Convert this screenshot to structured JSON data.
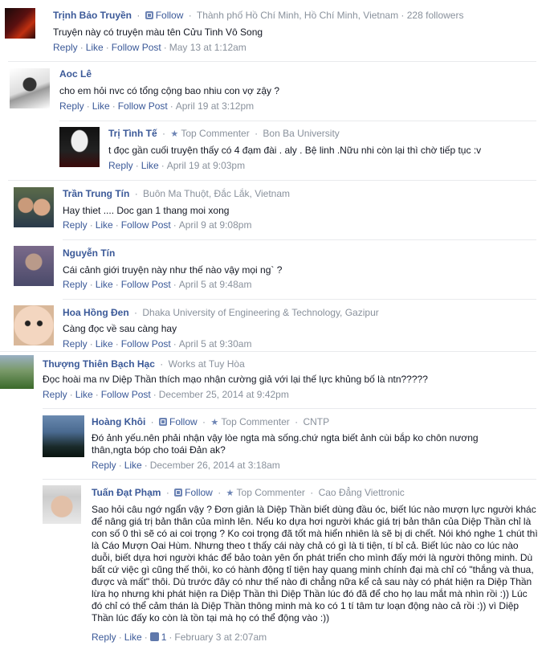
{
  "comments": [
    {
      "name": "Trịnh Bảo Truyền",
      "follow": "Follow",
      "meta": "Thành phố Hồ Chí Minh, Hồ Chí Minh, Vietnam · 228 followers",
      "text": "Truyện này có truyện màu tên Cửu Tinh Vô Song",
      "reply": "Reply",
      "like": "Like",
      "follow_post": "Follow Post",
      "date": "May 13 at 1:12am"
    },
    {
      "name": "Aoc Lê",
      "text": "cho em hỏi nvc có tổng cộng bao nhiu con vợ zậy ?",
      "reply": "Reply",
      "like": "Like",
      "follow_post": "Follow Post",
      "date": "April 19 at 3:12pm"
    },
    {
      "name": "Trị Tình Tế",
      "badge": "Top Commenter",
      "meta": "Bon Ba University",
      "text": "t đọc gần cuối truyện thấy có 4 đạm đài . aly . Bệ linh .Nữu nhi còn lại thì chờ tiếp tục :v",
      "reply": "Reply",
      "like": "Like",
      "date": "April 19 at 9:03pm"
    },
    {
      "name": "Trần Trung Tín",
      "meta": "Buôn Ma Thuột, Đắc Lắk, Vietnam",
      "text": "Hay thiet .... Doc gan 1 thang moi xong",
      "reply": "Reply",
      "like": "Like",
      "follow_post": "Follow Post",
      "date": "April 9 at 9:08pm"
    },
    {
      "name": "Nguyễn Tín",
      "text": "Cái cảnh giới truyện này như thế nào vậy mọi ng` ?",
      "reply": "Reply",
      "like": "Like",
      "follow_post": "Follow Post",
      "date": "April 5 at 9:48am"
    },
    {
      "name": "Hoa Hồng Đen",
      "meta": "Dhaka University of Engineering & Technology, Gazipur",
      "text": "Càng đọc về sau càng hay",
      "reply": "Reply",
      "like": "Like",
      "follow_post": "Follow Post",
      "date": "April 5 at 9:30am"
    },
    {
      "name": "Thượng Thiên Bạch Hạc",
      "meta": "Works at Tuy Hòa",
      "text": "Đọc hoài ma nv Diệp Thần thích mạo nhận cường giả với lại thế lực khủng bố là ntn?????",
      "reply": "Reply",
      "like": "Like",
      "follow_post": "Follow Post",
      "date": "December 25, 2014 at 9:42pm"
    },
    {
      "name": "Hoàng Khôi",
      "follow": "Follow",
      "badge": "Top Commenter",
      "meta": "CNTP",
      "text": "Đó ảnh yếu.nên phải nhận vậy lòe ngta mà sống.chứ ngta biết ảnh cùi bắp ko chôn nương thân,ngta bóp cho toái Đản ak?",
      "reply": "Reply",
      "like": "Like",
      "date": "December 26, 2014 at 3:18am"
    },
    {
      "name": "Tuấn Đạt Phạm",
      "follow": "Follow",
      "badge": "Top Commenter",
      "meta": "Cao Đẳng Viettronic",
      "text": "Sao hỏi câu ngớ ngẩn vậy ? Đơn giản là Diệp Thần biết dùng đầu óc, biết lúc nào mượn lực người khác để nâng giá trị bản thân của mình lên. Nếu ko dựa hơi người khác giá trị bản thân của Diệp Thần chỉ là con số 0 thì sẽ có ai coi trọng ? Ko coi trọng đã tốt mà hiển nhiên là sẽ bị di chết. Nói khó nghe 1 chút thì là Cáo Mượn Oai Hùm. Nhưng theo t thấy cái này chả có gì là ti tiện, tí bỉ cả. Biết lúc nào co lúc nào duỗi, biết dựa hơi người khác để bảo toàn yên ổn phát triển cho mình đấy mới là người thông minh. Dù bất cứ việc gì cũng thế thôi, ko có hành động tỉ tiện hay quang minh chính đại mà chỉ có \"thắng và thua, được và mất\" thôi. Dù trước đây có như thế nào đi chẳng nữa kể cả sau này có phát hiện ra Diệp Thần lừa họ nhưng khi phát hiện ra Diệp Thần thì Diệp Thần lúc đó đã để cho họ lau mắt mà nhìn rồi :)) Lúc đó chỉ có thể cảm thán là Diệp Thần thông minh mà ko có 1 tí tâm tư loạn động nào cả rồi :)) vì Diệp Thần lúc đấy ko còn là tồn tại mà họ có thể động vào :))",
      "reply": "Reply",
      "like": "Like",
      "like_count": "1",
      "date": "February 3 at 2:07am"
    }
  ],
  "colors": {
    "link": "#3b5998",
    "meta": "#89919c",
    "text": "#141823",
    "divider": "#e9eaed"
  }
}
